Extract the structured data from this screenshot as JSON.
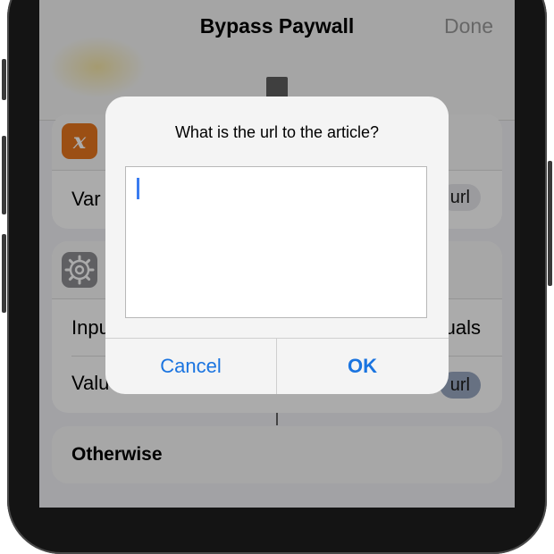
{
  "nav": {
    "title": "Bypass Paywall",
    "done_label": "Done"
  },
  "actions": {
    "set_variable": {
      "icon": "x-variable-icon",
      "icon_glyph": "x",
      "row_label": "Var",
      "pill": "url"
    },
    "if": {
      "icon": "gear-icon",
      "input_label": "Inpu",
      "input_value": "uals",
      "value_label": "Valu",
      "value_pill": "url"
    },
    "otherwise": {
      "label": "Otherwise"
    }
  },
  "alert": {
    "message": "What is the url to the article?",
    "input_value": "",
    "cancel_label": "Cancel",
    "ok_label": "OK"
  },
  "colors": {
    "accent": "#1a74e0",
    "variable_icon": "#e8761f",
    "gear_icon": "#8e8e93"
  }
}
